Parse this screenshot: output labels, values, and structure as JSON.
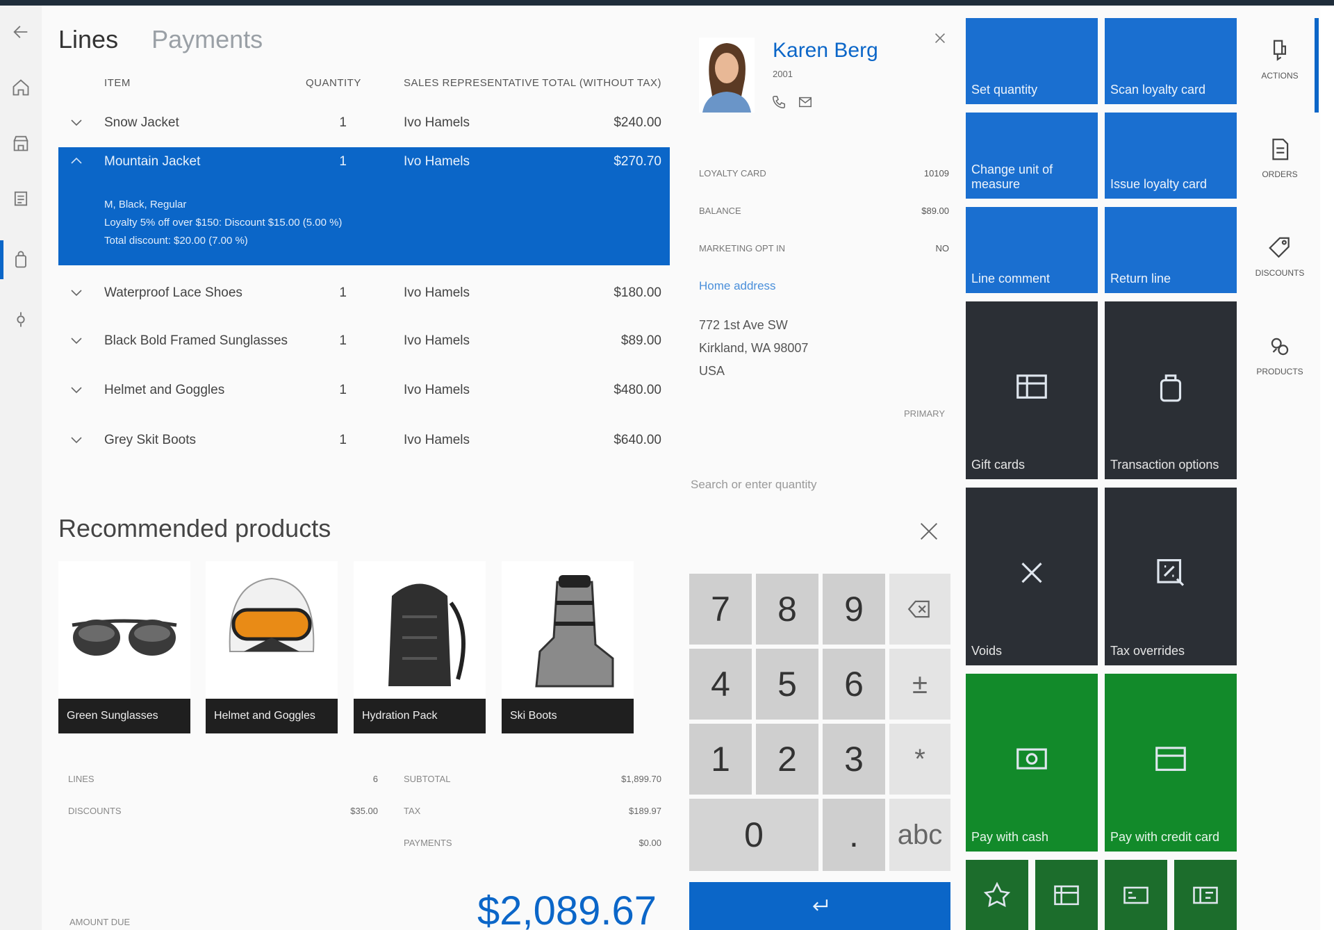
{
  "nav": {
    "items": [
      {
        "name": "back"
      },
      {
        "name": "home"
      },
      {
        "name": "store"
      },
      {
        "name": "reports"
      },
      {
        "name": "cart",
        "active": true
      },
      {
        "name": "settings"
      }
    ]
  },
  "tabs": [
    "Lines",
    "Payments"
  ],
  "lines_header": {
    "item": "Item",
    "quantity": "Quantity",
    "sales_rep": "Sales representative",
    "total": "Total (without tax)"
  },
  "lines": [
    {
      "item": "Snow Jacket",
      "qty": "1",
      "rep": "Ivo Hamels",
      "total": "$240.00"
    },
    {
      "item": "Mountain Jacket",
      "qty": "1",
      "rep": "Ivo Hamels",
      "total": "$270.70",
      "details": [
        "M, Black, Regular",
        "Loyalty 5% off over $150: Discount $15.00 (5.00 %)",
        "Total discount: $20.00 (7.00 %)"
      ]
    },
    {
      "item": "Waterproof Lace Shoes",
      "qty": "1",
      "rep": "Ivo Hamels",
      "total": "$180.00"
    },
    {
      "item": "Black Bold Framed Sunglasses",
      "qty": "1",
      "rep": "Ivo Hamels",
      "total": "$89.00"
    },
    {
      "item": "Helmet and Goggles",
      "qty": "1",
      "rep": "Ivo Hamels",
      "total": "$480.00"
    },
    {
      "item": "Grey Skit Boots",
      "qty": "1",
      "rep": "Ivo Hamels",
      "total": "$640.00"
    }
  ],
  "recommended": {
    "title": "Recommended products",
    "items": [
      "Green Sunglasses",
      "Helmet and Goggles",
      "Hydration Pack",
      "Ski Boots"
    ]
  },
  "totals": {
    "lines_label": "Lines",
    "lines_value": "6",
    "discounts_label": "Discounts",
    "discounts_value": "$35.00",
    "subtotal_label": "Subtotal",
    "subtotal_value": "$1,899.70",
    "tax_label": "Tax",
    "tax_value": "$189.97",
    "payments_label": "Payments",
    "payments_value": "$0.00",
    "amount_due_label": "Amount due",
    "amount_due_value": "$2,089.67"
  },
  "customer": {
    "name": "Karen Berg",
    "id": "2001",
    "loyalty_label": "Loyalty card",
    "loyalty_value": "10109",
    "balance_label": "Balance",
    "balance_value": "$89.00",
    "marketing_label": "Marketing opt in",
    "marketing_value": "No",
    "address_heading": "Home address",
    "address": [
      "772 1st Ave SW",
      "Kirkland, WA 98007",
      "USA"
    ],
    "address_tag": "Primary"
  },
  "numpad": {
    "placeholder": "Search or enter quantity",
    "keys": [
      "7",
      "8",
      "9",
      "4",
      "5",
      "6",
      "1",
      "2",
      "3",
      "0",
      "."
    ],
    "plusminus": "±",
    "star": "*",
    "abc": "abc"
  },
  "tiles": [
    {
      "label": "Set quantity",
      "style": "blue"
    },
    {
      "label": "Scan loyalty card",
      "style": "blue"
    },
    {
      "label": "Change unit of measure",
      "style": "blue"
    },
    {
      "label": "Issue loyalty card",
      "style": "blue"
    },
    {
      "label": "Line comment",
      "style": "blue"
    },
    {
      "label": "Return line",
      "style": "blue"
    },
    {
      "label": "Gift cards",
      "style": "dark",
      "icon": "gift-card-icon"
    },
    {
      "label": "Transaction options",
      "style": "dark",
      "icon": "bag-icon"
    },
    {
      "label": "Voids",
      "style": "dark",
      "icon": "x-icon"
    },
    {
      "label": "Tax overrides",
      "style": "dark",
      "icon": "tax-icon"
    },
    {
      "label": "Pay with cash",
      "style": "green",
      "icon": "cash-icon"
    },
    {
      "label": "Pay with credit card",
      "style": "green",
      "icon": "credit-card-icon"
    }
  ],
  "small_tiles": [
    "loyalty-icon",
    "card-icon",
    "check-icon",
    "store-credit-icon"
  ],
  "rightbar": [
    "Actions",
    "Orders",
    "Discounts",
    "Products"
  ],
  "colors": {
    "accent": "#0b66c8",
    "tile_blue": "#1a6fd0",
    "tile_dark": "#2b2f35",
    "tile_green": "#128a2a",
    "tile_dark_green": "#1c6d2c"
  }
}
